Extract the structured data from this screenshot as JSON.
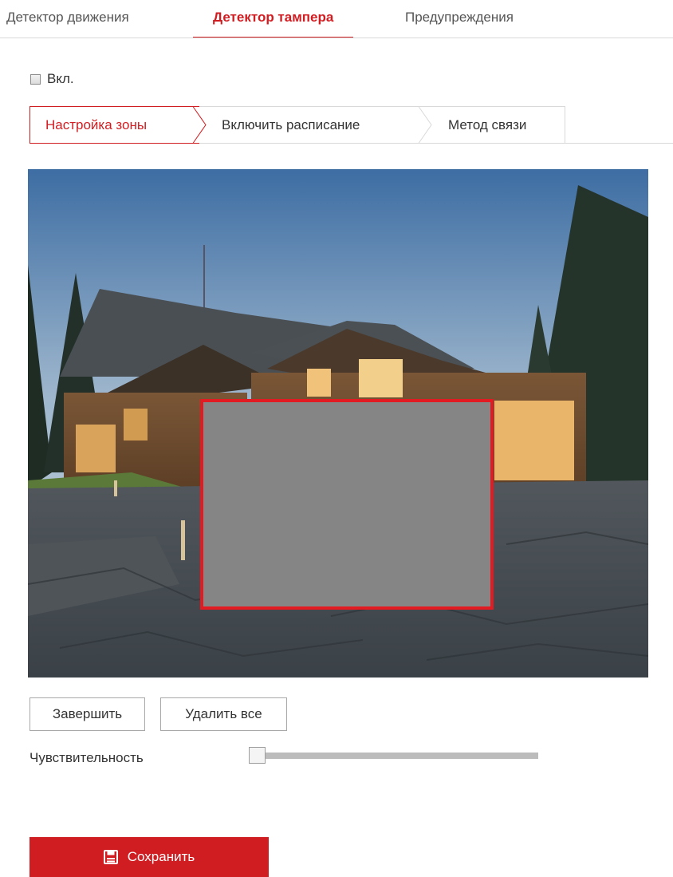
{
  "tabs": [
    {
      "label": "Детектор движения"
    },
    {
      "label": "Детектор тампера"
    },
    {
      "label": "Предупреждения"
    }
  ],
  "enable": {
    "label": "Вкл.",
    "checked": false
  },
  "steps": [
    {
      "label": "Настройка зоны"
    },
    {
      "label": "Включить расписание"
    },
    {
      "label": "Метод связи"
    }
  ],
  "buttons": {
    "finish": "Завершить",
    "delete_all": "Удалить все"
  },
  "sensitivity": {
    "label": "Чувствительность",
    "value": 0
  },
  "save": {
    "label": "Сохранить",
    "icon": "save-icon"
  },
  "colors": {
    "accent": "#d01d22",
    "zone_border": "#e21a22",
    "zone_fill": "#858585"
  }
}
